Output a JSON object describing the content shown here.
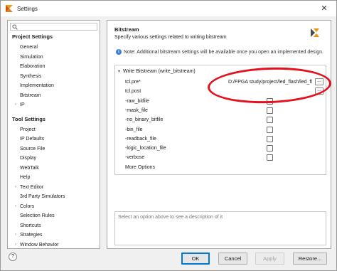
{
  "window": {
    "title": "Settings"
  },
  "search": {
    "placeholder": "",
    "icon": "search-icon"
  },
  "nav": {
    "project_settings": {
      "label": "Project Settings",
      "items": [
        {
          "label": "General",
          "expandable": false
        },
        {
          "label": "Simulation",
          "expandable": false
        },
        {
          "label": "Elaboration",
          "expandable": false
        },
        {
          "label": "Synthesis",
          "expandable": false
        },
        {
          "label": "Implementation",
          "expandable": false
        },
        {
          "label": "Bitstream",
          "expandable": false
        },
        {
          "label": "IP",
          "expandable": true
        }
      ]
    },
    "tool_settings": {
      "label": "Tool Settings",
      "items": [
        {
          "label": "Project",
          "expandable": false
        },
        {
          "label": "IP Defaults",
          "expandable": false
        },
        {
          "label": "Source File",
          "expandable": false
        },
        {
          "label": "Display",
          "expandable": false
        },
        {
          "label": "WebTalk",
          "expandable": false
        },
        {
          "label": "Help",
          "expandable": false
        },
        {
          "label": "Text Editor",
          "expandable": true
        },
        {
          "label": "3rd Party Simulators",
          "expandable": false
        },
        {
          "label": "Colors",
          "expandable": true
        },
        {
          "label": "Selection Rules",
          "expandable": false
        },
        {
          "label": "Shortcuts",
          "expandable": false
        },
        {
          "label": "Strategies",
          "expandable": true
        },
        {
          "label": "Window Behavior",
          "expandable": true
        }
      ]
    }
  },
  "page": {
    "title": "Bitstream",
    "subtitle": "Specify various settings related to writing bitstream",
    "note": "Note: Additional bitstream settings will be available once you open an implemented design."
  },
  "group": {
    "label": "Write Bitstream (write_bitstream)"
  },
  "properties": [
    {
      "label": "tcl.pre*",
      "type": "file",
      "value": "D:/FPGA study/project/led_flash/led_fla..."
    },
    {
      "label": "tcl.post",
      "type": "file",
      "value": ""
    },
    {
      "label": "-raw_bitfile",
      "type": "checkbox",
      "checked": false
    },
    {
      "label": "-mask_file",
      "type": "checkbox",
      "checked": false
    },
    {
      "label": "-no_binary_bitfile",
      "type": "checkbox",
      "checked": false
    },
    {
      "label": "-bin_file",
      "type": "checkbox",
      "checked": false
    },
    {
      "label": "-readback_file",
      "type": "checkbox",
      "checked": false
    },
    {
      "label": "-logic_location_file",
      "type": "checkbox",
      "checked": false
    },
    {
      "label": "-verbose",
      "type": "checkbox",
      "checked": false
    },
    {
      "label": "More Options",
      "type": "text",
      "value": ""
    }
  ],
  "browse_label": "...",
  "description": {
    "placeholder": "Select an option above to see a description of it"
  },
  "buttons": {
    "help": "?",
    "ok": "OK",
    "cancel": "Cancel",
    "apply": "Apply",
    "restore": "Restore..."
  },
  "colors": {
    "highlight_oval": "#e5101c",
    "info": "#3b7dd8"
  }
}
